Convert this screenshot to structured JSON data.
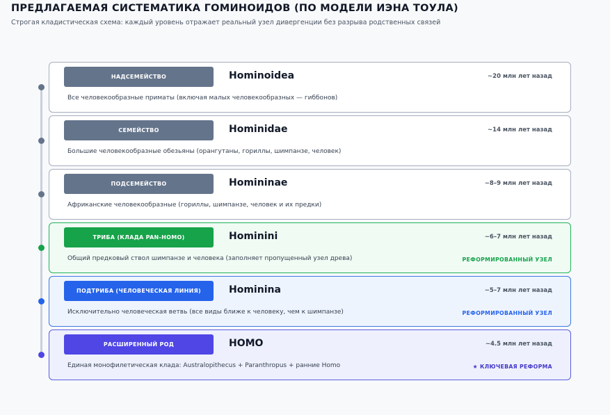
{
  "header": {
    "title": "ПРЕДЛАГАЕМАЯ СИСТЕМАТИКА ГОМИНОИДОВ (ПО МОДЕЛИ ИЭНА ТОУЛА)",
    "subtitle": "Строгая кладистическая схема: каждый уровень отражает реальный узел дивергенции без разрыва родственных связей"
  },
  "levels": [
    {
      "rank": "НАДСЕМЕЙСТВО",
      "name": "Hominoidea",
      "age": "~20 млн лет назад",
      "description": "Все человекообразные приматы (включая малых человекообразных — гиббонов)",
      "note": "",
      "colors": {
        "badge": "#64748b",
        "border": "#a7aebd",
        "background": "#ffffff",
        "dot": "#64748b",
        "note": "#64748b"
      }
    },
    {
      "rank": "СЕМЕЙСТВО",
      "name": "Hominidae",
      "age": "~14 млн лет назад",
      "description": "Большие человекообразные обезьяны (орангутаны, гориллы, шимпанзе, человек)",
      "note": "",
      "colors": {
        "badge": "#64748b",
        "border": "#a7aebd",
        "background": "#ffffff",
        "dot": "#64748b",
        "note": "#64748b"
      }
    },
    {
      "rank": "ПОДСЕМЕЙСТВО",
      "name": "Homininae",
      "age": "~8–9 млн лет назад",
      "description": "Африканские человекообразные (гориллы, шимпанзе, человек и их предки)",
      "note": "",
      "colors": {
        "badge": "#64748b",
        "border": "#a7aebd",
        "background": "#ffffff",
        "dot": "#64748b",
        "note": "#64748b"
      }
    },
    {
      "rank": "ТРИБА (КЛАДА PAN-HOMO)",
      "name": "Hominini",
      "age": "~6–7 млн лет назад",
      "description": "Общий предковый ствол шимпанзе и человека (заполняет пропущенный узел древа)",
      "note": "РЕФОРМИРОВАННЫЙ УЗЕЛ",
      "colors": {
        "badge": "#16a34a",
        "border": "#22b45a",
        "background": "#f0fbf4",
        "dot": "#16a34a",
        "note": "#16a34a"
      }
    },
    {
      "rank": "ПОДТРИБА (ЧЕЛОВЕЧЕСКАЯ ЛИНИЯ)",
      "name": "Hominina",
      "age": "~5–7 млн лет назад",
      "description": "Исключительно человеческая ветвь (все виды ближе к человеку, чем к шимпанзе)",
      "note": "РЕФОРМИРОВАННЫЙ УЗЕЛ",
      "colors": {
        "badge": "#2563eb",
        "border": "#3b78e0",
        "background": "#eef4fe",
        "dot": "#2563eb",
        "note": "#2563eb"
      }
    },
    {
      "rank": "РАСШИРЕННЫЙ РОД",
      "name": "HOMO",
      "age": "~4.5 млн лет назад",
      "description": "Единая монофилетическая клада: Australopithecus + Paranthropus + ранние Homo",
      "note": "★ КЛЮЧЕВАЯ РЕФОРМА",
      "colors": {
        "badge": "#4f46e5",
        "border": "#5b5ee0",
        "background": "#eef0fd",
        "dot": "#4f46e5",
        "note": "#4338ca"
      }
    }
  ]
}
